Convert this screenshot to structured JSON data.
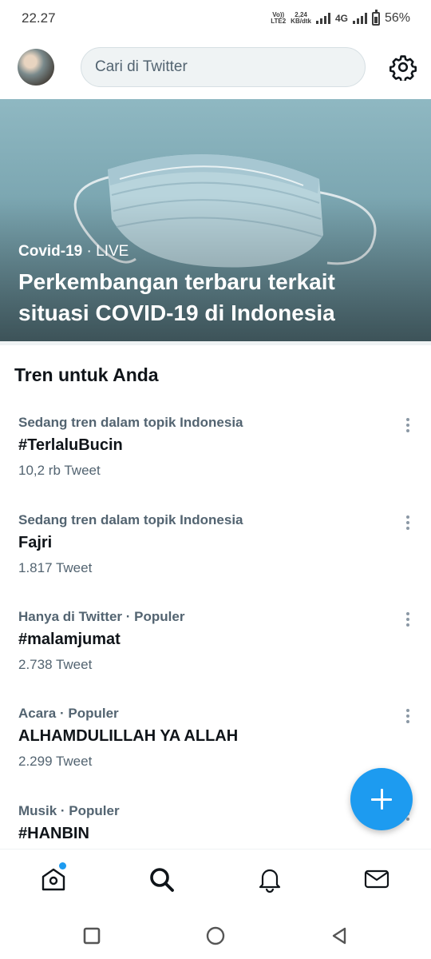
{
  "status_bar": {
    "time": "22.27",
    "volte": "VoLTE2",
    "volte_line1": "Vo))",
    "volte_line2": "LTE2",
    "speed_value": "2,24",
    "speed_unit": "KB/dtk",
    "network": "4G",
    "battery": "56%"
  },
  "header": {
    "search_placeholder": "Cari di Twitter"
  },
  "hero": {
    "category": "Covid-19",
    "separator": " · ",
    "live": "LIVE",
    "title": "Perkembangan terbaru terkait situasi COVID-19 di Indonesia"
  },
  "section": {
    "title": "Tren untuk Anda"
  },
  "trends": [
    {
      "meta": "Sedang tren dalam topik Indonesia",
      "name": "#TerlaluBucin",
      "count": "10,2 rb Tweet"
    },
    {
      "meta": "Sedang tren dalam topik Indonesia",
      "name": "Fajri",
      "count": "1.817 Tweet"
    },
    {
      "meta": "Hanya di Twitter · Populer",
      "name": "#malamjumat",
      "count": "2.738 Tweet"
    },
    {
      "meta": "Acara · Populer",
      "name": "ALHAMDULILLAH YA ALLAH",
      "count": "2.299 Tweet"
    },
    {
      "meta": "Musik · Populer",
      "name": "#HANBIN",
      "count": ""
    }
  ],
  "colors": {
    "accent": "#1d9bf0",
    "text_primary": "#0f1419",
    "text_secondary": "#536471"
  },
  "icons": {
    "settings": "gear-icon",
    "home": "home-icon",
    "explore": "search-icon",
    "notifications": "bell-icon",
    "messages": "mail-icon",
    "compose": "plus-icon"
  }
}
